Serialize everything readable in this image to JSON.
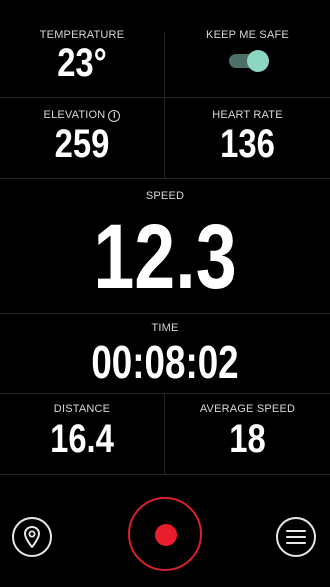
{
  "metrics": {
    "temperature": {
      "label": "TEMPERATURE",
      "value": "23°"
    },
    "keep_me_safe": {
      "label": "KEEP ME SAFE",
      "enabled": true,
      "color": "#8bd7c4"
    },
    "elevation": {
      "label": "ELEVATION",
      "info_glyph": "i",
      "value": "259"
    },
    "heart_rate": {
      "label": "HEART RATE",
      "value": "136"
    },
    "speed": {
      "label": "SPEED",
      "value": "12.3"
    },
    "time": {
      "label": "TIME",
      "value": "00:08:02"
    },
    "distance": {
      "label": "DISTANCE",
      "value": "16.4"
    },
    "average_speed": {
      "label": "AVERAGE SPEED",
      "value": "18"
    }
  },
  "controls": {
    "map_icon": "map-pin-icon",
    "record_icon": "record-icon",
    "menu_icon": "hamburger-menu-icon",
    "record_color": "#ea1d2c"
  }
}
